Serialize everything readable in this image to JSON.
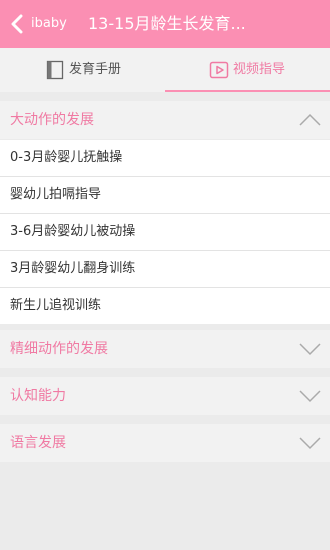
{
  "header": {
    "back_label": "ibaby",
    "title": "13-15月龄生长发育..."
  },
  "tabs": [
    {
      "label": "发育手册",
      "icon": "book-icon",
      "active": false
    },
    {
      "label": "视频指导",
      "icon": "play-icon",
      "active": true
    }
  ],
  "sections": [
    {
      "title": "大动作的发展",
      "expanded": true,
      "items": [
        "0-3月龄婴儿抚触操",
        "婴幼儿拍嗝指导",
        "3-6月龄婴幼儿被动操",
        "3月龄婴幼儿翻身训练",
        "新生儿追视训练"
      ]
    },
    {
      "title": "精细动作的发展",
      "expanded": false
    },
    {
      "title": "认知能力",
      "expanded": false
    },
    {
      "title": "语言发展",
      "expanded": false
    }
  ],
  "colors": {
    "accent": "#fb8fb3",
    "accent_text": "#f07aa3",
    "background": "#ebebeb"
  }
}
